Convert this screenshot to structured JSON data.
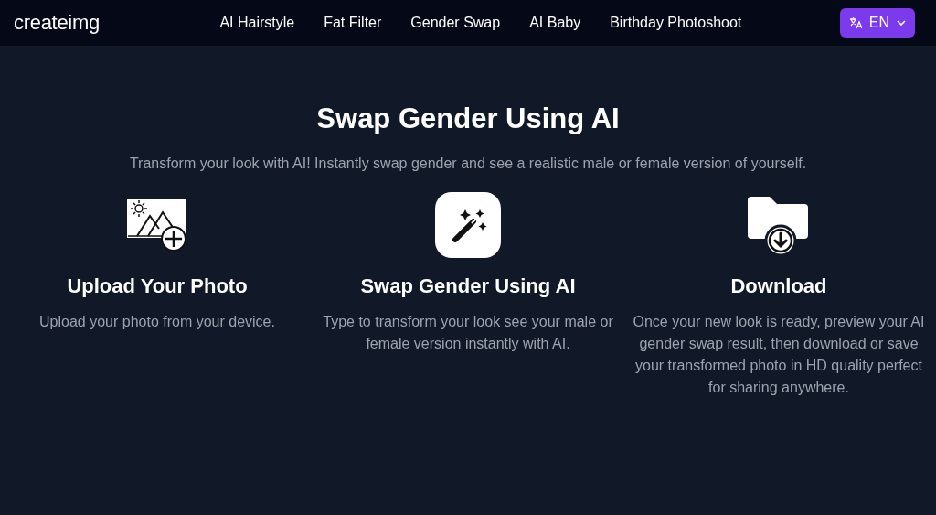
{
  "header": {
    "logo": "createimg",
    "nav": [
      {
        "label": "AI Hairstyle"
      },
      {
        "label": "Fat Filter"
      },
      {
        "label": "Gender Swap"
      },
      {
        "label": "AI Baby"
      },
      {
        "label": "Birthday Photoshoot"
      }
    ],
    "language": "EN"
  },
  "title": "Swap Gender Using AI",
  "subtitle": "Transform your look with AI! Instantly swap gender and see a realistic male or female version of yourself.",
  "steps": [
    {
      "kind": "upload",
      "heading": "Upload Your Photo",
      "text": "Upload your photo from your device."
    },
    {
      "kind": "wand",
      "heading": "Swap Gender Using AI",
      "text": "Type to transform your look see your male or female version instantly with AI."
    },
    {
      "kind": "download",
      "heading": "Download",
      "text": "Once your new look is ready, preview your AI gender swap result, then download or save your transformed photo in HD quality perfect for sharing anywhere."
    }
  ]
}
